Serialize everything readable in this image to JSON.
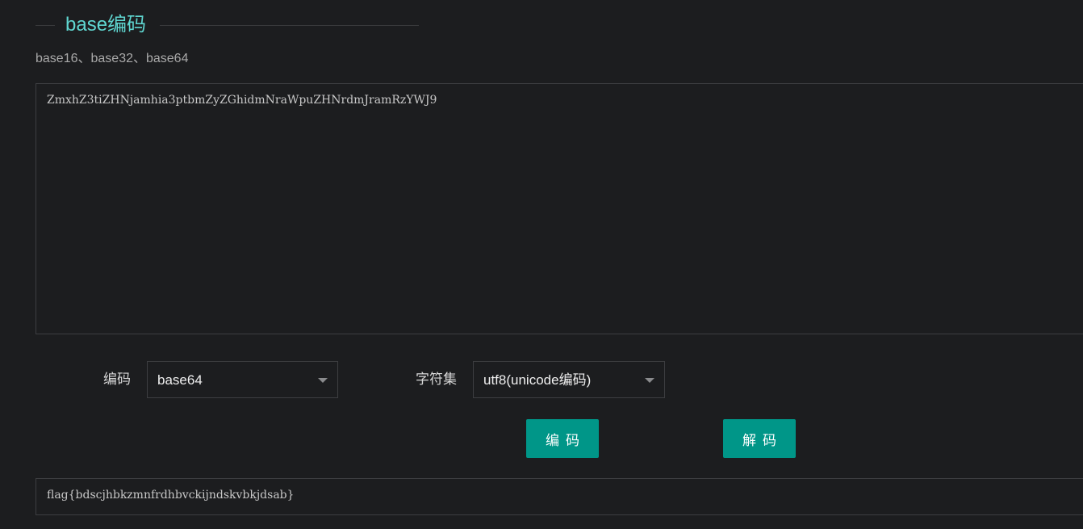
{
  "section": {
    "title": "base编码",
    "subtitle": "base16、base32、base64"
  },
  "input": {
    "value": "ZmxhZ3tiZHNjamhia3ptbmZyZGhidmNraWpuZHNrdmJramRzYWJ9"
  },
  "controls": {
    "encoding_label": "编码",
    "encoding_value": "base64",
    "charset_label": "字符集",
    "charset_value": "utf8(unicode编码)"
  },
  "buttons": {
    "encode_label": "编码",
    "decode_label": "解码"
  },
  "output": {
    "value": "flag{bdscjhbkzmnfrdhbvckijndskvbkjdsab}"
  },
  "colors": {
    "background": "#1c1d1f",
    "accent_title": "#5fd6d0",
    "button": "#009688",
    "border": "#3d3e41"
  },
  "icons": {
    "select_arrow": "caret-down-icon"
  }
}
